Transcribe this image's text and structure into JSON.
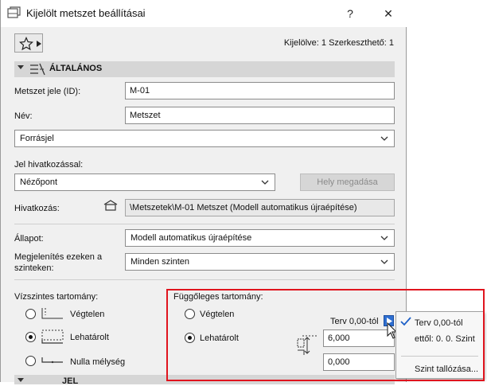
{
  "window": {
    "title": "Kijelölt metszet beállításai",
    "help_label": "?",
    "close_label": "✕"
  },
  "header": {
    "selection_status": "Kijelölve: 1 Szerkeszthető: 1"
  },
  "section": {
    "title": "ÁLTALÁNOS"
  },
  "fields": {
    "id_label": "Metszet jele (ID):",
    "id_value": "M-01",
    "name_label": "Név:",
    "name_value": "Metszet",
    "marker_select": "Forrásjel",
    "ref_label": "Jel hivatkozással:",
    "ref_select": "Nézőpont",
    "set_location_button": "Hely megadása",
    "reference_label": "Hivatkozás:",
    "reference_value": "\\Metszetek\\M-01 Metszet (Modell automatikus újraépítése)",
    "status_label": "Állapot:",
    "status_select": "Modell automatikus újraépítése",
    "show_on_label_line1": "Megjelenítés ezeken a",
    "show_on_label_line2": "szinteken:",
    "show_on_select": "Minden szinten"
  },
  "horizontal": {
    "title": "Vízszintes tartomány:",
    "options": [
      "Végtelen",
      "Lehatárolt",
      "Nulla mélység"
    ],
    "selected_index": 1
  },
  "vertical": {
    "title": "Függőleges tartomány:",
    "options": [
      "Végtelen",
      "Lehatárolt"
    ],
    "selected_index": 1,
    "terv_label": "Terv 0,00-tól",
    "top_value": "6,000",
    "bottom_value": "0,000"
  },
  "popup": {
    "item_checked": "Terv 0,00-tól",
    "item_from": "ettől: 0. 0. Szint",
    "item_browse": "Szint tallózása..."
  },
  "next_section": {
    "title": "JEL"
  },
  "colors": {
    "highlight_frame": "#e0141e",
    "popup_button": "#2f6fd1"
  }
}
